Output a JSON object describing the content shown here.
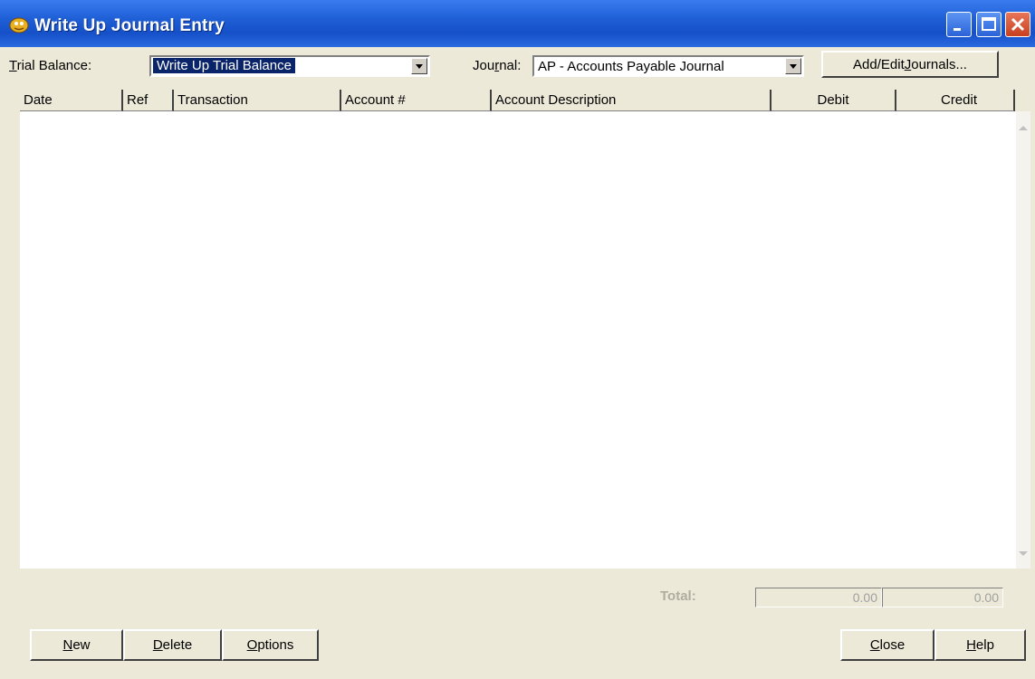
{
  "window": {
    "title": "Write Up Journal Entry"
  },
  "trial_balance": {
    "label_pre": "",
    "label_u": "T",
    "label_post": "rial Balance:",
    "value": "Write Up Trial Balance"
  },
  "journal": {
    "label_pre": "Jou",
    "label_u": "r",
    "label_post": "nal:",
    "value": "AP - Accounts Payable Journal"
  },
  "add_edit": {
    "pre": "Add/Edit ",
    "u": "J",
    "post": "ournals..."
  },
  "grid": {
    "columns": [
      "Date",
      "Ref",
      "Transaction",
      "Account #",
      "Account Description",
      "Debit",
      "Credit"
    ]
  },
  "totals": {
    "label": "Total:",
    "debit": "0.00",
    "credit": "0.00"
  },
  "buttons": {
    "new": {
      "u": "N",
      "rest": "ew"
    },
    "delete": {
      "u": "D",
      "rest": "elete"
    },
    "options": {
      "u": "O",
      "rest": "ptions"
    },
    "close": {
      "u": "C",
      "rest": "lose"
    },
    "help": {
      "u": "H",
      "rest": "elp"
    }
  }
}
